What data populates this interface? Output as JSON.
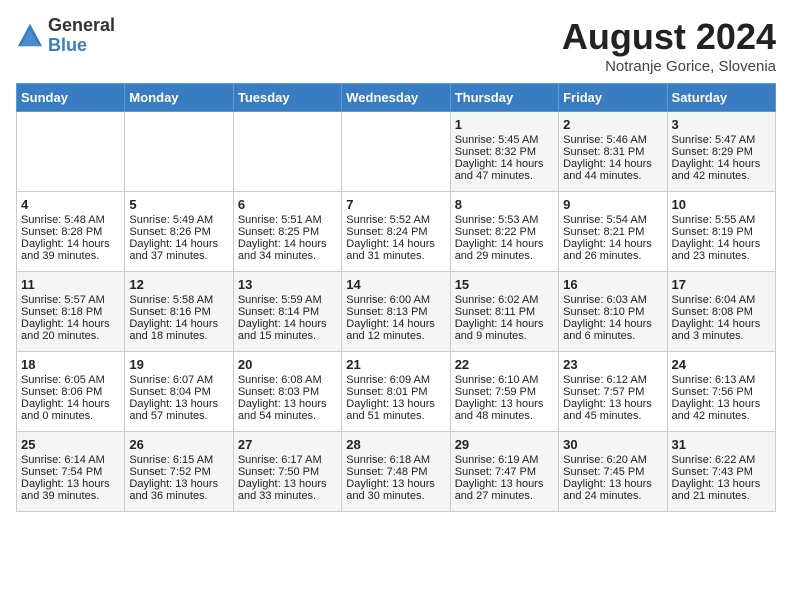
{
  "header": {
    "logo_general": "General",
    "logo_blue": "Blue",
    "month_year": "August 2024",
    "location": "Notranje Gorice, Slovenia"
  },
  "calendar": {
    "days_of_week": [
      "Sunday",
      "Monday",
      "Tuesday",
      "Wednesday",
      "Thursday",
      "Friday",
      "Saturday"
    ],
    "weeks": [
      [
        {
          "day": "",
          "content": ""
        },
        {
          "day": "",
          "content": ""
        },
        {
          "day": "",
          "content": ""
        },
        {
          "day": "",
          "content": ""
        },
        {
          "day": "1",
          "content": "Sunrise: 5:45 AM\nSunset: 8:32 PM\nDaylight: 14 hours and 47 minutes."
        },
        {
          "day": "2",
          "content": "Sunrise: 5:46 AM\nSunset: 8:31 PM\nDaylight: 14 hours and 44 minutes."
        },
        {
          "day": "3",
          "content": "Sunrise: 5:47 AM\nSunset: 8:29 PM\nDaylight: 14 hours and 42 minutes."
        }
      ],
      [
        {
          "day": "4",
          "content": "Sunrise: 5:48 AM\nSunset: 8:28 PM\nDaylight: 14 hours and 39 minutes."
        },
        {
          "day": "5",
          "content": "Sunrise: 5:49 AM\nSunset: 8:26 PM\nDaylight: 14 hours and 37 minutes."
        },
        {
          "day": "6",
          "content": "Sunrise: 5:51 AM\nSunset: 8:25 PM\nDaylight: 14 hours and 34 minutes."
        },
        {
          "day": "7",
          "content": "Sunrise: 5:52 AM\nSunset: 8:24 PM\nDaylight: 14 hours and 31 minutes."
        },
        {
          "day": "8",
          "content": "Sunrise: 5:53 AM\nSunset: 8:22 PM\nDaylight: 14 hours and 29 minutes."
        },
        {
          "day": "9",
          "content": "Sunrise: 5:54 AM\nSunset: 8:21 PM\nDaylight: 14 hours and 26 minutes."
        },
        {
          "day": "10",
          "content": "Sunrise: 5:55 AM\nSunset: 8:19 PM\nDaylight: 14 hours and 23 minutes."
        }
      ],
      [
        {
          "day": "11",
          "content": "Sunrise: 5:57 AM\nSunset: 8:18 PM\nDaylight: 14 hours and 20 minutes."
        },
        {
          "day": "12",
          "content": "Sunrise: 5:58 AM\nSunset: 8:16 PM\nDaylight: 14 hours and 18 minutes."
        },
        {
          "day": "13",
          "content": "Sunrise: 5:59 AM\nSunset: 8:14 PM\nDaylight: 14 hours and 15 minutes."
        },
        {
          "day": "14",
          "content": "Sunrise: 6:00 AM\nSunset: 8:13 PM\nDaylight: 14 hours and 12 minutes."
        },
        {
          "day": "15",
          "content": "Sunrise: 6:02 AM\nSunset: 8:11 PM\nDaylight: 14 hours and 9 minutes."
        },
        {
          "day": "16",
          "content": "Sunrise: 6:03 AM\nSunset: 8:10 PM\nDaylight: 14 hours and 6 minutes."
        },
        {
          "day": "17",
          "content": "Sunrise: 6:04 AM\nSunset: 8:08 PM\nDaylight: 14 hours and 3 minutes."
        }
      ],
      [
        {
          "day": "18",
          "content": "Sunrise: 6:05 AM\nSunset: 8:06 PM\nDaylight: 14 hours and 0 minutes."
        },
        {
          "day": "19",
          "content": "Sunrise: 6:07 AM\nSunset: 8:04 PM\nDaylight: 13 hours and 57 minutes."
        },
        {
          "day": "20",
          "content": "Sunrise: 6:08 AM\nSunset: 8:03 PM\nDaylight: 13 hours and 54 minutes."
        },
        {
          "day": "21",
          "content": "Sunrise: 6:09 AM\nSunset: 8:01 PM\nDaylight: 13 hours and 51 minutes."
        },
        {
          "day": "22",
          "content": "Sunrise: 6:10 AM\nSunset: 7:59 PM\nDaylight: 13 hours and 48 minutes."
        },
        {
          "day": "23",
          "content": "Sunrise: 6:12 AM\nSunset: 7:57 PM\nDaylight: 13 hours and 45 minutes."
        },
        {
          "day": "24",
          "content": "Sunrise: 6:13 AM\nSunset: 7:56 PM\nDaylight: 13 hours and 42 minutes."
        }
      ],
      [
        {
          "day": "25",
          "content": "Sunrise: 6:14 AM\nSunset: 7:54 PM\nDaylight: 13 hours and 39 minutes."
        },
        {
          "day": "26",
          "content": "Sunrise: 6:15 AM\nSunset: 7:52 PM\nDaylight: 13 hours and 36 minutes."
        },
        {
          "day": "27",
          "content": "Sunrise: 6:17 AM\nSunset: 7:50 PM\nDaylight: 13 hours and 33 minutes."
        },
        {
          "day": "28",
          "content": "Sunrise: 6:18 AM\nSunset: 7:48 PM\nDaylight: 13 hours and 30 minutes."
        },
        {
          "day": "29",
          "content": "Sunrise: 6:19 AM\nSunset: 7:47 PM\nDaylight: 13 hours and 27 minutes."
        },
        {
          "day": "30",
          "content": "Sunrise: 6:20 AM\nSunset: 7:45 PM\nDaylight: 13 hours and 24 minutes."
        },
        {
          "day": "31",
          "content": "Sunrise: 6:22 AM\nSunset: 7:43 PM\nDaylight: 13 hours and 21 minutes."
        }
      ]
    ]
  }
}
